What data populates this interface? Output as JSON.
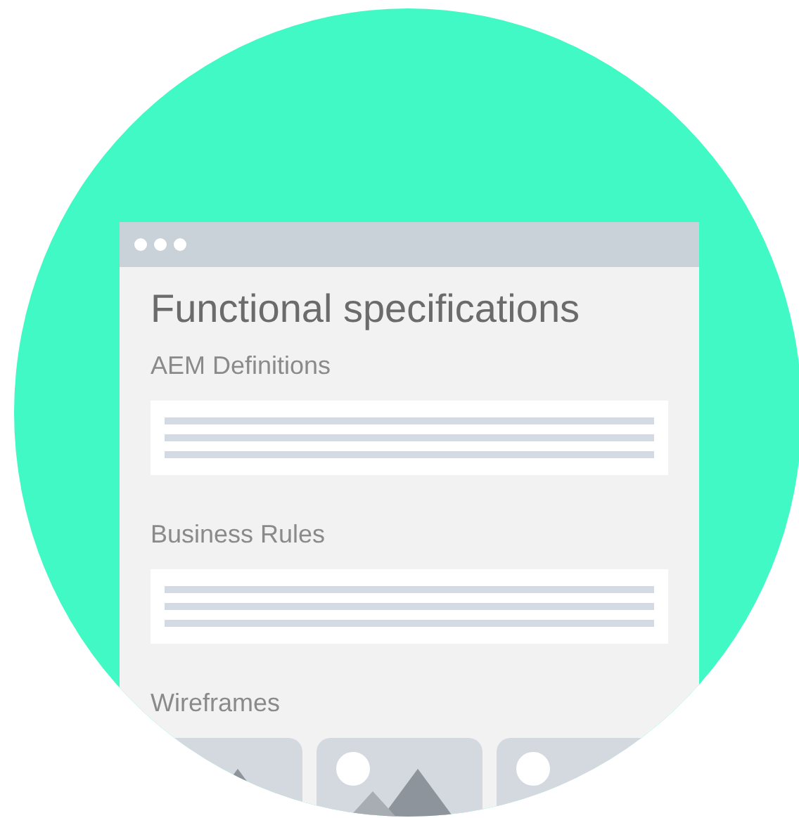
{
  "window": {
    "title": "Functional specifications"
  },
  "sections": [
    {
      "label": "AEM Definitions",
      "kind": "text"
    },
    {
      "label": "Business Rules",
      "kind": "text"
    },
    {
      "label": "Wireframes",
      "kind": "images"
    }
  ]
}
